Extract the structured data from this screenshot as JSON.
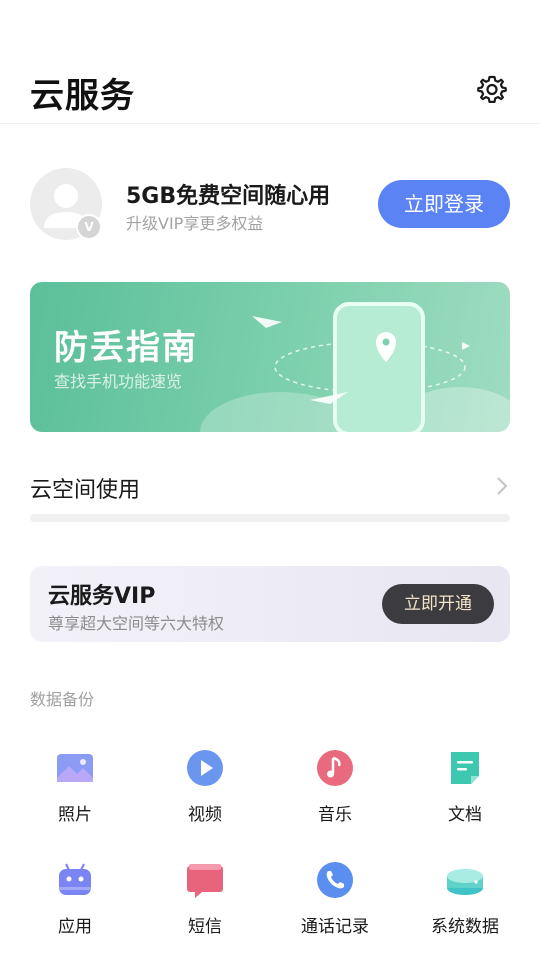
{
  "header": {
    "title": "云服务",
    "settings_icon": "gear-icon"
  },
  "account": {
    "title": "5GB免费空间随心用",
    "subtitle": "升级VIP享更多权益",
    "login_label": "立即登录",
    "avatar_badge": "V"
  },
  "banner": {
    "title": "防丢指南",
    "subtitle": "查找手机功能速览"
  },
  "usage": {
    "label": "云空间使用"
  },
  "vip": {
    "title": "云服务VIP",
    "subtitle": "尊享超大空间等六大特权",
    "button_label": "立即开通"
  },
  "backup": {
    "section_label": "数据备份",
    "items": [
      {
        "label": "照片",
        "icon": "photo-icon"
      },
      {
        "label": "视频",
        "icon": "video-icon"
      },
      {
        "label": "音乐",
        "icon": "music-icon"
      },
      {
        "label": "文档",
        "icon": "document-icon"
      },
      {
        "label": "应用",
        "icon": "android-app-icon"
      },
      {
        "label": "短信",
        "icon": "message-icon"
      },
      {
        "label": "通话记录",
        "icon": "phone-icon"
      },
      {
        "label": "系统数据",
        "icon": "system-data-icon"
      }
    ]
  },
  "colors": {
    "accent_blue": "#5b83f3",
    "banner_green": "#6fc9a4",
    "vip_dark": "#3c3b40"
  }
}
